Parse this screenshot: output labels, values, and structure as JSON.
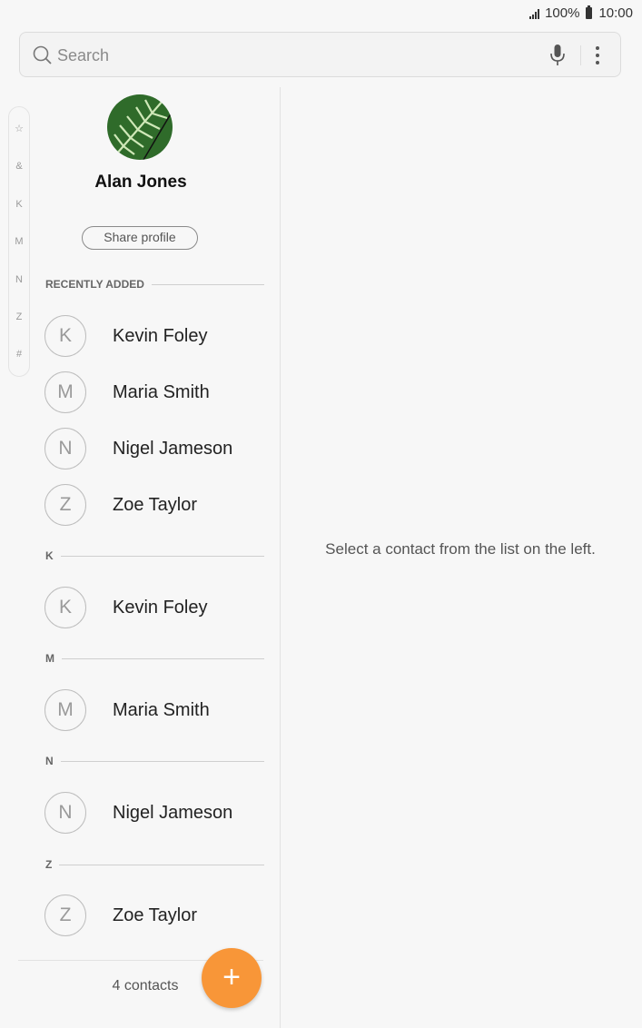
{
  "status": {
    "signal_icon": "signal-icon",
    "battery_percent": "100%",
    "time": "10:00"
  },
  "search": {
    "placeholder": "Search",
    "icon": "search-icon",
    "mic_icon": "mic-icon",
    "more_icon": "more-vert-icon"
  },
  "index_letters": [
    "☆",
    "&",
    "K",
    "M",
    "N",
    "Z",
    "#"
  ],
  "profile": {
    "name": "Alan Jones",
    "share_label": "Share profile"
  },
  "recent": {
    "header": "RECENTLY ADDED",
    "contacts": [
      {
        "initial": "K",
        "name": "Kevin Foley"
      },
      {
        "initial": "M",
        "name": "Maria Smith"
      },
      {
        "initial": "N",
        "name": "Nigel Jameson"
      },
      {
        "initial": "Z",
        "name": "Zoe Taylor"
      }
    ]
  },
  "groups": [
    {
      "letter": "K",
      "contact": {
        "initial": "K",
        "name": "Kevin Foley"
      }
    },
    {
      "letter": "M",
      "contact": {
        "initial": "M",
        "name": "Maria Smith"
      }
    },
    {
      "letter": "N",
      "contact": {
        "initial": "N",
        "name": "Nigel Jameson"
      }
    },
    {
      "letter": "Z",
      "contact": {
        "initial": "Z",
        "name": "Zoe Taylor"
      }
    }
  ],
  "footer": {
    "count_label": "4 contacts",
    "fab_icon": "plus-icon",
    "fab_symbol": "+"
  },
  "detail": {
    "message": "Select a contact from the list on the left."
  },
  "colors": {
    "accent": "#f89638"
  }
}
